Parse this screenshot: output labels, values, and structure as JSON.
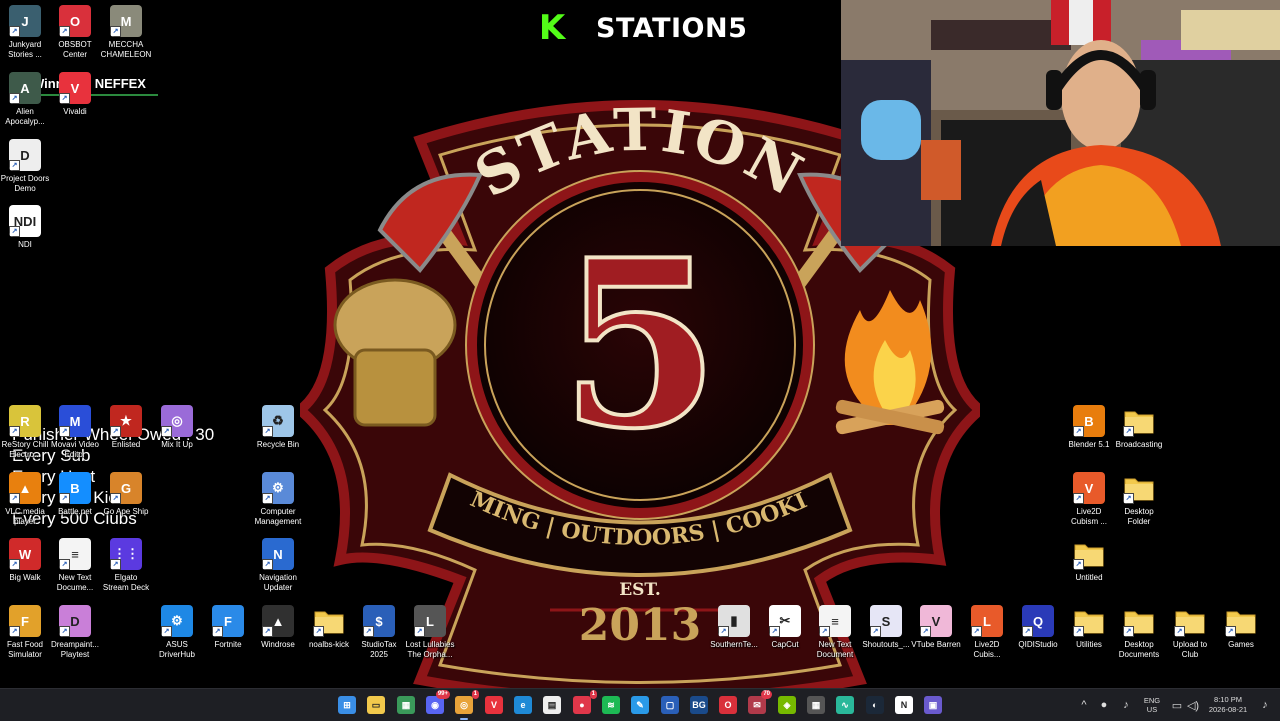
{
  "desktop": {
    "left_icons": [
      {
        "label": "Junkyard\nStories ...",
        "icon": "junkyard-icon",
        "color": "#3a5f6f",
        "glyph": "J"
      },
      {
        "label": "OBSBOT\nCenter",
        "icon": "obsbot-icon",
        "color": "#d9303b",
        "glyph": "O"
      },
      {
        "label": "MECCHA\nCHAMELEON",
        "icon": "chameleon-icon",
        "color": "#8a8a7a",
        "glyph": "M"
      },
      {
        "label": "Alien\nApocalyp...",
        "icon": "alien-icon",
        "color": "#3e5a4a",
        "glyph": "A"
      },
      {
        "label": "Vivaldi",
        "icon": "vivaldi-icon",
        "color": "#e8323d",
        "glyph": "V"
      },
      {
        "label": "Project Doors\nDemo",
        "icon": "doors-icon",
        "color": "#eeeeee",
        "glyph": "D"
      },
      {
        "label": "NDI",
        "icon": "ndi-icon",
        "color": "#ffffff",
        "glyph": "NDI"
      },
      {
        "label": "ReStory Chill\nElectro...",
        "icon": "restory-icon",
        "color": "#d9c43a",
        "glyph": "R"
      },
      {
        "label": "Movavi Video\nEditor",
        "icon": "movavi-icon",
        "color": "#2a4ed8",
        "glyph": "M"
      },
      {
        "label": "Enlisted",
        "icon": "enlisted-icon",
        "color": "#c0271f",
        "glyph": "★"
      },
      {
        "label": "Mix It Up",
        "icon": "mixitup-icon",
        "color": "#9a6bd8",
        "glyph": "◎"
      },
      {
        "label": "VLC media\nplayer",
        "icon": "vlc-icon",
        "color": "#e8800e",
        "glyph": "▲"
      },
      {
        "label": "Battle.net",
        "icon": "battlenet-icon",
        "color": "#148eff",
        "glyph": "B"
      },
      {
        "label": "Go Ape Ship",
        "icon": "goape-icon",
        "color": "#d8842a",
        "glyph": "G"
      },
      {
        "label": "Big Walk",
        "icon": "bigwalk-icon",
        "color": "#d02a2a",
        "glyph": "W"
      },
      {
        "label": "New Text\nDocume...",
        "icon": "text-document-icon",
        "color": "#f4f4f4",
        "glyph": "≡"
      },
      {
        "label": "Elgato\nStream Deck",
        "icon": "streamdeck-icon",
        "color": "#5b3ae0",
        "glyph": "⋮⋮"
      },
      {
        "label": "Fast Food\nSimulator",
        "icon": "fastfood-icon",
        "color": "#e2a12a",
        "glyph": "F"
      },
      {
        "label": "Dreampaint...\nPlaytest",
        "icon": "dreampaint-icon",
        "color": "#c97fd8",
        "glyph": "D"
      }
    ],
    "middle_icons": [
      {
        "label": "Recycle Bin",
        "icon": "recycle-bin-icon",
        "color": "#9ec6e8",
        "glyph": "♻"
      },
      {
        "label": "Computer\nManagement",
        "icon": "computer-management-icon",
        "color": "#5a8ad8",
        "glyph": "⚙"
      },
      {
        "label": "Navigation\nUpdater",
        "icon": "navigation-updater-icon",
        "color": "#2a6ad0",
        "glyph": "N"
      }
    ],
    "bottom_icons": [
      {
        "label": "ASUS\nDriverHub",
        "icon": "asus-driverhub-icon",
        "color": "#1e88e5",
        "glyph": "⚙"
      },
      {
        "label": "Fortnite",
        "icon": "fortnite-icon",
        "color": "#2a8ae8",
        "glyph": "F"
      },
      {
        "label": "Windrose",
        "icon": "windrose-icon",
        "color": "#303030",
        "glyph": "▲"
      },
      {
        "label": "noalbs-kick",
        "icon": "folder-icon",
        "color": "#f2c94c",
        "glyph": ""
      },
      {
        "label": "StudioTax\n2025",
        "icon": "studiotax-icon",
        "color": "#2a5fb8",
        "glyph": "$"
      },
      {
        "label": "Lost Lullabies\nThe Orpha...",
        "icon": "lost-lullabies-icon",
        "color": "#555555",
        "glyph": "L"
      },
      {
        "label": "SouthernTe...",
        "icon": "file-icon",
        "color": "#e0e0e0",
        "glyph": "▮"
      },
      {
        "label": "CapCut",
        "icon": "capcut-icon",
        "color": "#ffffff",
        "glyph": "✂"
      },
      {
        "label": "New Text\nDocument",
        "icon": "text-document-icon",
        "color": "#f4f4f4",
        "glyph": "≡"
      },
      {
        "label": "Shoutouts_...",
        "icon": "shoutouts-icon",
        "color": "#e6e6f6",
        "glyph": "S"
      },
      {
        "label": "VTube Barren",
        "icon": "vtube-icon",
        "color": "#f0b8d8",
        "glyph": "V"
      },
      {
        "label": "Live2D\nCubis...",
        "icon": "live2d-icon",
        "color": "#e85a2a",
        "glyph": "L"
      },
      {
        "label": "QIDIStudio",
        "icon": "qidistudio-icon",
        "color": "#2a3ab8",
        "glyph": "Q"
      },
      {
        "label": "Utilities",
        "icon": "folder-icon",
        "color": "#f2c94c",
        "glyph": ""
      },
      {
        "label": "Desktop\nDocuments",
        "icon": "folder-icon",
        "color": "#f2c94c",
        "glyph": ""
      },
      {
        "label": "Upload to\nClub",
        "icon": "folder-icon",
        "color": "#f2c94c",
        "glyph": ""
      },
      {
        "label": "Games",
        "icon": "folder-icon",
        "color": "#f2c94c",
        "glyph": ""
      }
    ],
    "right_icons": [
      {
        "label": "Blender 5.1",
        "icon": "blender-icon",
        "color": "#e87d0d",
        "glyph": "B"
      },
      {
        "label": "Broadcasting",
        "icon": "folder-icon",
        "color": "#f2c94c",
        "glyph": ""
      },
      {
        "label": "Live2D\nCubism ...",
        "icon": "live2d-icon",
        "color": "#e85a2a",
        "glyph": "V"
      },
      {
        "label": "Desktop\nFolder",
        "icon": "folder-icon",
        "color": "#f2c94c",
        "glyph": ""
      },
      {
        "label": "Untitled",
        "icon": "folder-icon",
        "color": "#f2c94c",
        "glyph": ""
      }
    ]
  },
  "overlay": {
    "kick_logo": "K",
    "channel_title": "STATION5",
    "now_playing": "Winning - NEFFEX",
    "wheel_lines": [
      "Punisher Wheel Owed : 30",
      "Every Sub",
      "Every Host",
      "Every 500 Kicks",
      "Every 500 Clubs"
    ]
  },
  "logo": {
    "top_text": "STATION",
    "number": "5",
    "banner": "GAMING | OUTDOORS | COOKING",
    "est": "EST.",
    "year": "2013",
    "colors": {
      "red": "#8e1518",
      "dark_red": "#5a0a0c",
      "gold": "#c9a35a",
      "cream": "#f2e4c6"
    }
  },
  "taskbar": {
    "apps": [
      {
        "name": "start-button",
        "icon": "windows-icon",
        "color": "#3a8ee6",
        "glyph": "⊞"
      },
      {
        "name": "file-explorer",
        "icon": "folder-icon",
        "color": "#f2c94c",
        "glyph": "▭"
      },
      {
        "name": "store",
        "icon": "store-icon",
        "color": "#3a9a5a",
        "glyph": "▦"
      },
      {
        "name": "discord",
        "icon": "discord-icon",
        "color": "#5865f2",
        "glyph": "◉",
        "badge": "99+"
      },
      {
        "name": "chrome",
        "icon": "chrome-icon",
        "color": "#e8a33a",
        "glyph": "◎",
        "active": true,
        "badge": "1"
      },
      {
        "name": "vivaldi",
        "icon": "vivaldi-icon",
        "color": "#e8323d",
        "glyph": "V"
      },
      {
        "name": "edge",
        "icon": "edge-icon",
        "color": "#1f8ad6",
        "glyph": "e"
      },
      {
        "name": "notepad",
        "icon": "notepad-icon",
        "color": "#eeeeee",
        "glyph": "▤"
      },
      {
        "name": "recorder",
        "icon": "recorder-icon",
        "color": "#e0374a",
        "glyph": "●",
        "badge": "1"
      },
      {
        "name": "spotify",
        "icon": "spotify-icon",
        "color": "#1db954",
        "glyph": "≋"
      },
      {
        "name": "editor",
        "icon": "pen-icon",
        "color": "#2a9ae8",
        "glyph": "✎"
      },
      {
        "name": "obs-window",
        "icon": "window-icon",
        "color": "#2a5fb8",
        "glyph": "▢"
      },
      {
        "name": "bg-app",
        "icon": "bg-icon",
        "color": "#1a4a8a",
        "glyph": "BG"
      },
      {
        "name": "obsbot",
        "icon": "obsbot-icon",
        "color": "#d9303b",
        "glyph": "O"
      },
      {
        "name": "mail",
        "icon": "mail-icon",
        "color": "#b03a4a",
        "glyph": "✉",
        "badge": "70"
      },
      {
        "name": "app-gpu",
        "icon": "gpu-icon",
        "color": "#76b900",
        "glyph": "◈"
      },
      {
        "name": "calculator",
        "icon": "calculator-icon",
        "color": "#555555",
        "glyph": "▦"
      },
      {
        "name": "audio-app",
        "icon": "waveform-icon",
        "color": "#2ab89a",
        "glyph": "∿"
      },
      {
        "name": "steam",
        "icon": "steam-icon",
        "color": "#1b2838",
        "glyph": "◐"
      },
      {
        "name": "ndi",
        "icon": "ndi-icon",
        "color": "#ffffff",
        "glyph": "N"
      },
      {
        "name": "terminal",
        "icon": "terminal-icon",
        "color": "#6a5acd",
        "glyph": "▣"
      }
    ],
    "tray": {
      "lang_top": "ENG",
      "lang_bottom": "US",
      "time": "8:10 PM",
      "date": "2026-08-21"
    }
  }
}
